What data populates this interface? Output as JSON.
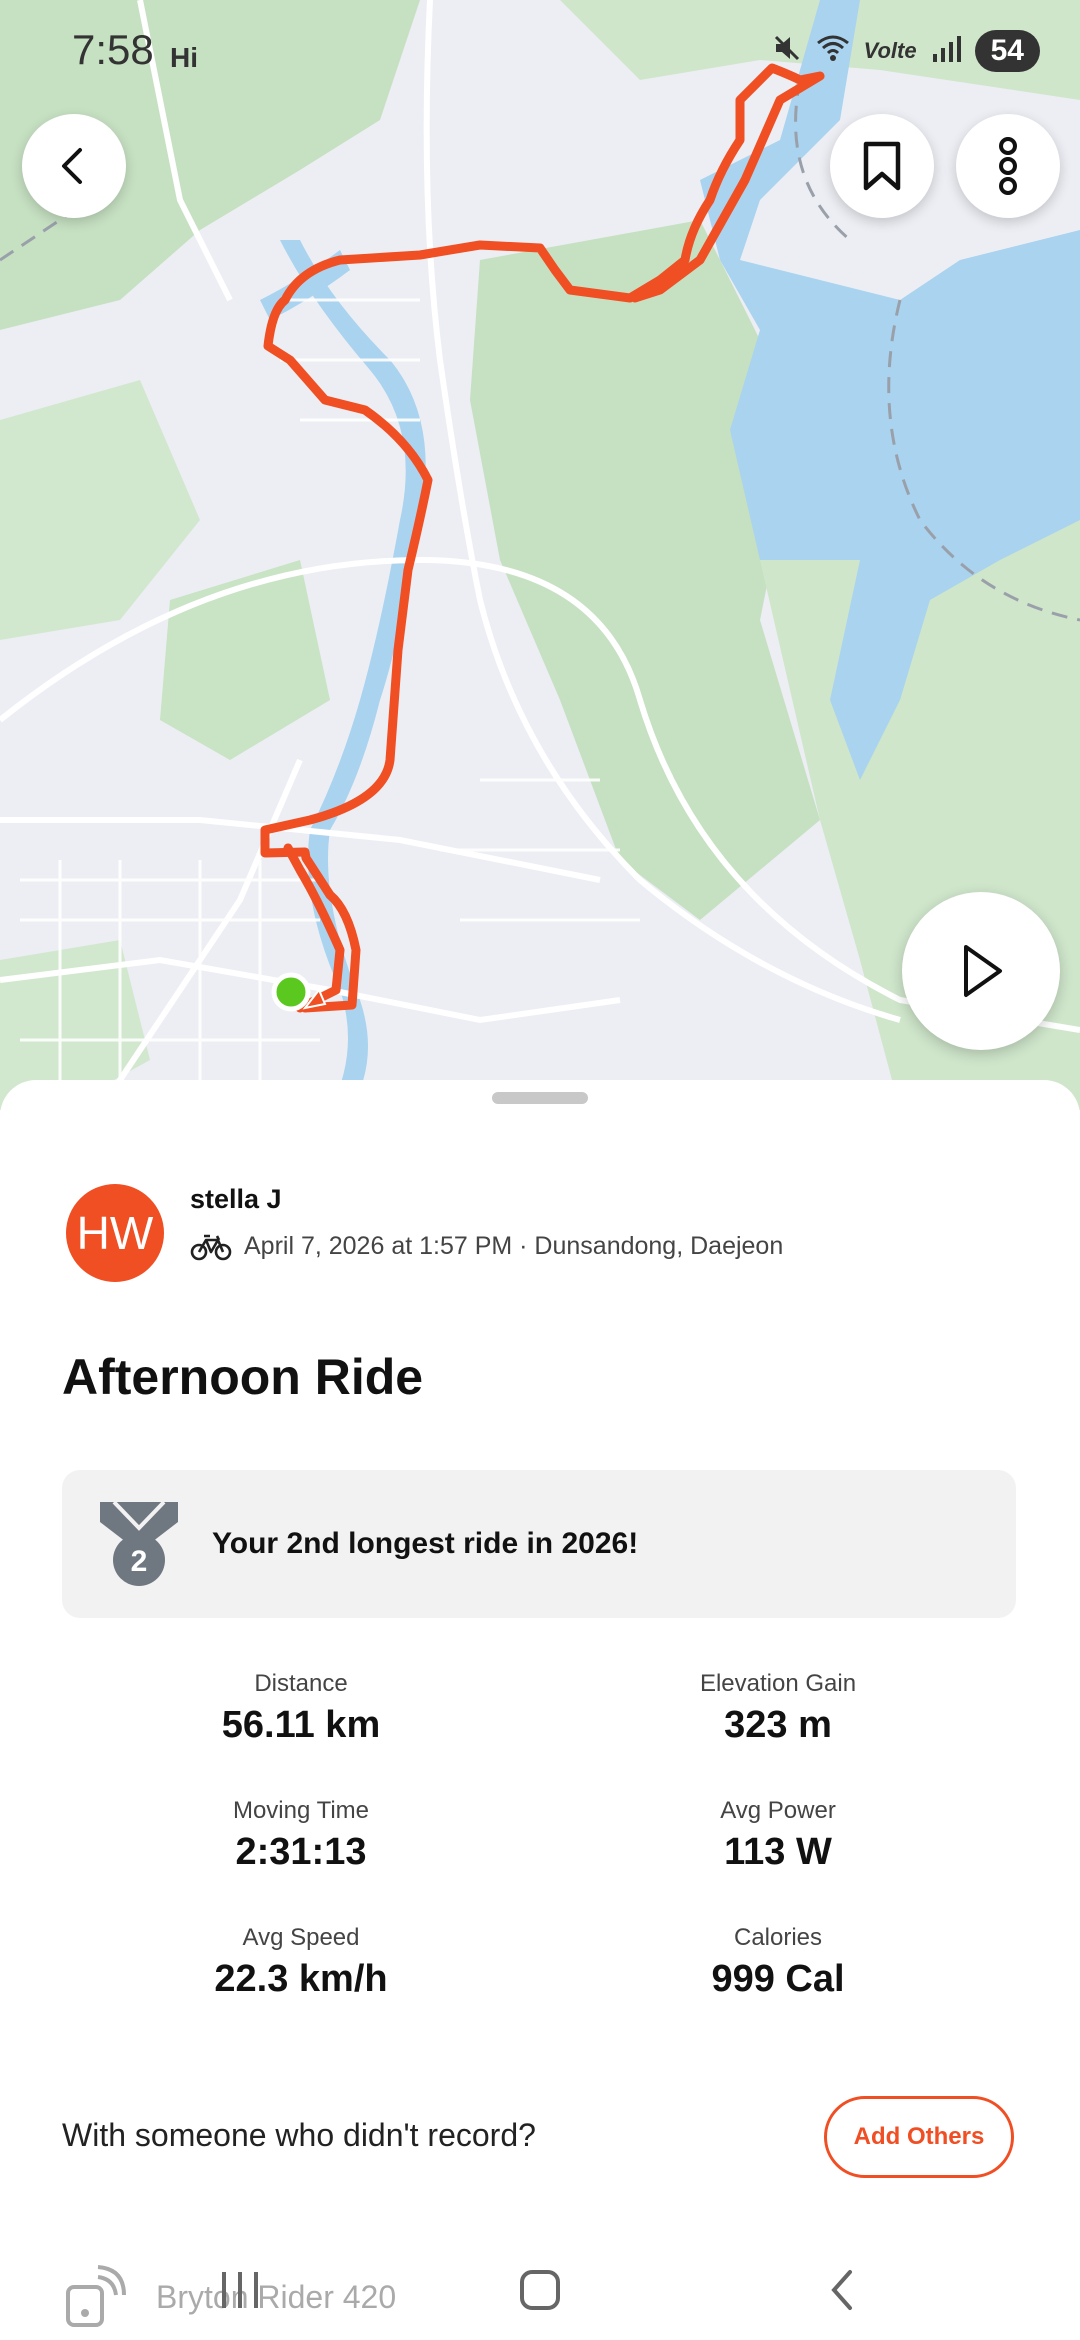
{
  "status_bar": {
    "time": "7:58",
    "carrier_tag": "Hi",
    "network": "Volte",
    "battery": "54"
  },
  "map": {
    "route_color": "#f04e23",
    "start_marker_color": "#5ac81e",
    "water_color": "#a9d3ef",
    "forest_color": "#c6e0c2"
  },
  "activity": {
    "avatar_initials": "HW",
    "athlete_name": "stella J",
    "sport_icon": "bike-icon",
    "meta": "April 7, 2026 at 1:57 PM · Dunsandong, Daejeon",
    "title": "Afternoon Ride",
    "achievement": {
      "medal_number": "2",
      "text": "Your 2nd longest ride in 2026!"
    },
    "stats": [
      {
        "label": "Distance",
        "value": "56.11 km"
      },
      {
        "label": "Elevation Gain",
        "value": "323 m"
      },
      {
        "label": "Moving Time",
        "value": "2:31:13"
      },
      {
        "label": "Avg Power",
        "value": "113 W"
      },
      {
        "label": "Avg Speed",
        "value": "22.3 km/h"
      },
      {
        "label": "Calories",
        "value": "999 Cal"
      }
    ],
    "with_others_prompt": "With someone who didn't record?",
    "add_others_label": "Add Others",
    "device_name": "Bryton Rider 420"
  },
  "accent_color": "#f04e23"
}
